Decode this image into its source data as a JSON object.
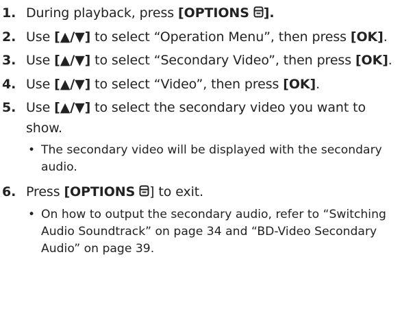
{
  "steps": [
    {
      "num": "1.",
      "pre": "During playback, press ",
      "open": "[",
      "bold": "OPTIONS",
      "close": "].",
      "icon": "options-icon"
    },
    {
      "num": "2.",
      "pre": "Use ",
      "arrows": "[▲/▼]",
      "mid": " to select “Operation Menu”, then press ",
      "ok": "[OK]",
      "post": "."
    },
    {
      "num": "3.",
      "pre": "Use ",
      "arrows": "[▲/▼]",
      "mid": " to select “Secondary Video”, then press ",
      "ok": "[OK]",
      "post": "."
    },
    {
      "num": "4.",
      "pre": "Use ",
      "arrows": "[▲/▼]",
      "mid": " to select “Video”, then press ",
      "ok": "[OK]",
      "post": "."
    },
    {
      "num": "5.",
      "pre": "Use ",
      "arrows": "[▲/▼]",
      "mid": " to select the secondary video you want to show.",
      "bullet": "The secondary video will be displayed with the secondary audio."
    },
    {
      "num": "6.",
      "pre": "Press ",
      "open": "[",
      "bold": "OPTIONS",
      "close": "] to exit.",
      "icon": "options-icon",
      "bullet": "On how to output the secondary audio, refer to “Switching Audio Soundtrack” on page 34 and “BD-Video Secondary Audio” on page 39."
    }
  ],
  "bullet_char": "•"
}
